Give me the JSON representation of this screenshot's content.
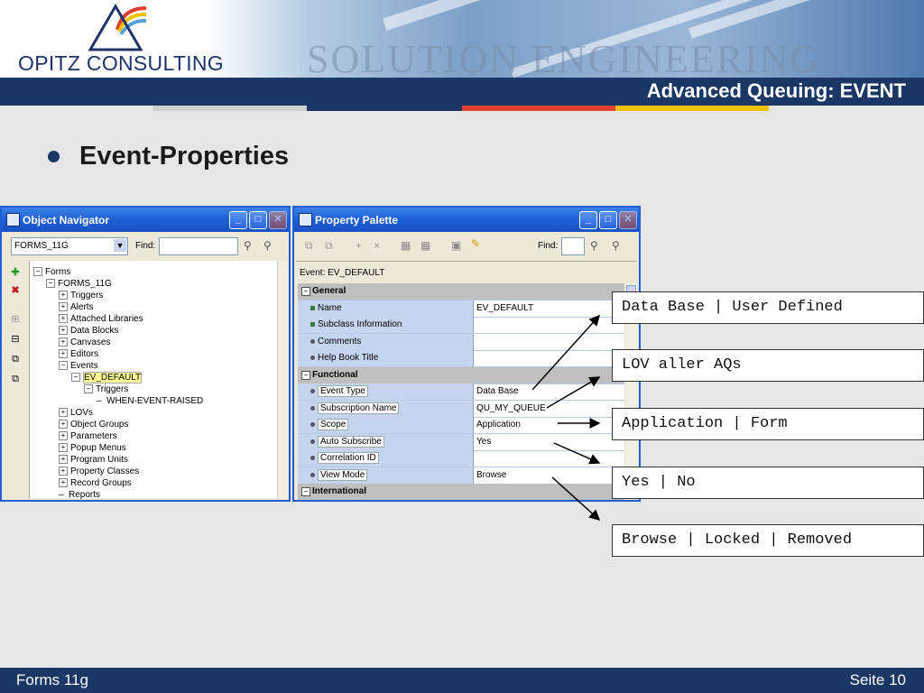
{
  "header": {
    "company": "OPITZ CONSULTING",
    "watermark": "SOLUTION ENGINEERING",
    "title": "Advanced Queuing: EVENT"
  },
  "colors": {
    "navy": "#1b3766",
    "strip": [
      "#cfcfcf",
      "#1b3766",
      "#e04030",
      "#f2c200"
    ]
  },
  "bullet": {
    "text": "Event-Properties"
  },
  "object_navigator": {
    "title": "Object Navigator",
    "module_select": "FORMS_11G",
    "find_label": "Find:",
    "tree": [
      {
        "label": "Forms",
        "depth": 0,
        "expanded": true
      },
      {
        "label": "FORMS_11G",
        "depth": 1,
        "expanded": true
      },
      {
        "label": "Triggers",
        "depth": 2,
        "expanded": false
      },
      {
        "label": "Alerts",
        "depth": 2,
        "expanded": false
      },
      {
        "label": "Attached Libraries",
        "depth": 2,
        "expanded": false
      },
      {
        "label": "Data Blocks",
        "depth": 2,
        "expanded": false
      },
      {
        "label": "Canvases",
        "depth": 2,
        "expanded": false
      },
      {
        "label": "Editors",
        "depth": 2,
        "expanded": false
      },
      {
        "label": "Events",
        "depth": 2,
        "expanded": true
      },
      {
        "label": "EV_DEFAULT",
        "depth": 3,
        "expanded": true,
        "selected": true
      },
      {
        "label": "Triggers",
        "depth": 4,
        "expanded": true
      },
      {
        "label": "WHEN-EVENT-RAISED",
        "depth": 5,
        "leaf": true
      },
      {
        "label": "LOVs",
        "depth": 2,
        "expanded": false
      },
      {
        "label": "Object Groups",
        "depth": 2,
        "expanded": false
      },
      {
        "label": "Parameters",
        "depth": 2,
        "expanded": false
      },
      {
        "label": "Popup Menus",
        "depth": 2,
        "expanded": false
      },
      {
        "label": "Program Units",
        "depth": 2,
        "expanded": false
      },
      {
        "label": "Property Classes",
        "depth": 2,
        "expanded": false
      },
      {
        "label": "Record Groups",
        "depth": 2,
        "expanded": false
      },
      {
        "label": "Reports",
        "depth": 2,
        "leaf": true
      }
    ]
  },
  "property_palette": {
    "title": "Property Palette",
    "find_label": "Find:",
    "event_line": "Event: EV_DEFAULT",
    "rows": [
      {
        "type": "category",
        "name": "General"
      },
      {
        "type": "prop",
        "name": "Name",
        "value": "EV_DEFAULT",
        "mark": "square"
      },
      {
        "type": "prop",
        "name": "Subclass Information",
        "value": "",
        "mark": "square"
      },
      {
        "type": "prop",
        "name": "Comments",
        "value": ""
      },
      {
        "type": "prop",
        "name": "Help Book Title",
        "value": ""
      },
      {
        "type": "category",
        "name": "Functional"
      },
      {
        "type": "prop",
        "name": "Event Type",
        "value": "Data Base",
        "boxed": true
      },
      {
        "type": "prop",
        "name": "Subscription Name",
        "value": "QU_MY_QUEUE",
        "boxed": true
      },
      {
        "type": "prop",
        "name": "Scope",
        "value": "Application",
        "boxed": true
      },
      {
        "type": "prop",
        "name": "Auto Subscribe",
        "value": "Yes",
        "boxed": true
      },
      {
        "type": "prop",
        "name": "Correlation ID",
        "value": "",
        "boxed": true
      },
      {
        "type": "prop",
        "name": "View Mode",
        "value": "Browse",
        "boxed": true
      },
      {
        "type": "category",
        "name": "International"
      }
    ]
  },
  "callouts": [
    "Data Base | User Defined",
    "LOV aller AQs",
    "Application | Form",
    "Yes | No",
    "Browse | Locked | Removed"
  ],
  "footer": {
    "left": "Forms 11g",
    "right": "Seite 10"
  }
}
